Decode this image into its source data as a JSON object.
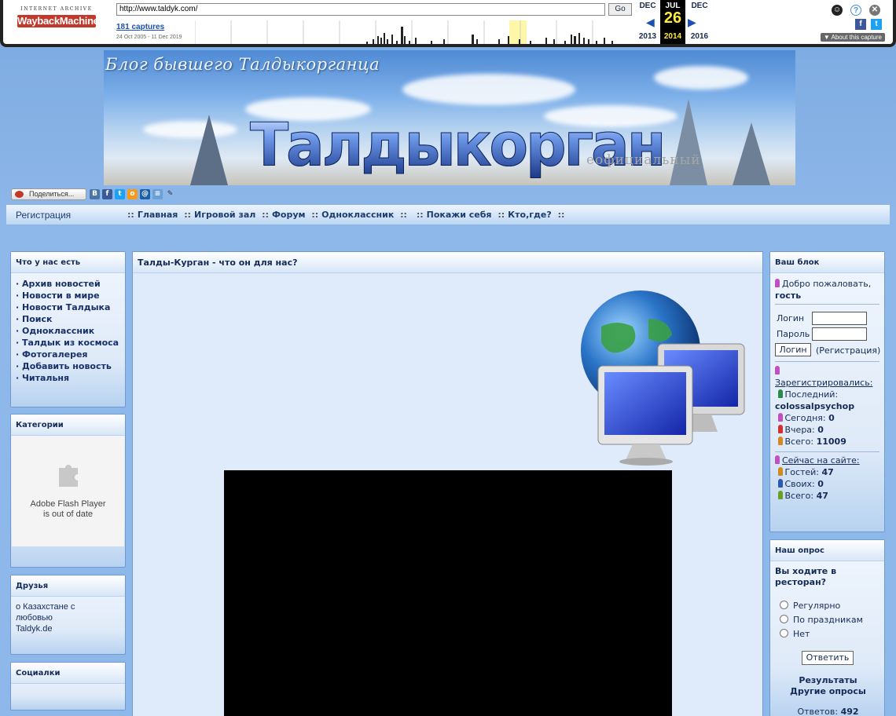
{
  "wayback": {
    "url": "http://www.taldyk.com/",
    "go_label": "Go",
    "captures": "181 captures",
    "range": "24 Oct 2005 - 11 Dec 2019",
    "logo_top": "INTERNET ARCHIVE",
    "logo_main": "WaybackMachine",
    "prev_month": "DEC",
    "cur_month": "JUL",
    "next_month": "DEC",
    "cur_day": "26",
    "prev_year": "2013",
    "cur_year": "2014",
    "next_year": "2016",
    "about": "▼ About this capture",
    "icons": [
      "user-icon",
      "help-icon",
      "close-icon",
      "facebook-icon",
      "twitter-icon"
    ]
  },
  "header": {
    "blog_title": "Блог бывшего Талдыкорганца",
    "city": "Талдыкорган",
    "unofficial": "еофициальный"
  },
  "share": {
    "label": "Поделиться...",
    "icons": [
      "vk-icon",
      "facebook-icon",
      "twitter-icon",
      "odnoklassniki-icon",
      "mailru-icon",
      "liveinternet-icon",
      "bookmark-icon"
    ]
  },
  "nav": {
    "register": "Регистрация",
    "links": [
      "Главная",
      "Игровой зал",
      "Форум",
      "Одноклассник",
      "",
      "Покажи себя",
      "Кто,где?"
    ]
  },
  "left": {
    "menu_title": "Что у нас есть",
    "menu": [
      "· Архив новостей",
      "· Новости в мире",
      "· Новости Талдыка",
      "· Поиск",
      "· Одноклассник",
      "· Талдык из космоса",
      "· Фотогалерея",
      "· Добавить новость",
      "· Читальня"
    ],
    "categories_title": "Категории",
    "flash_line1": "Adobe Flash Player",
    "flash_line2": "is out of date",
    "friends_title": "Друзья",
    "friends": [
      "о Казахстане с",
      "любовью",
      "Taldyk.de"
    ],
    "social_title": "Социалки"
  },
  "center": {
    "title": "Талды-Курган - что он для нас?"
  },
  "right": {
    "block_title": "Ваш блок",
    "welcome": "Добро пожаловать,",
    "guest": "гость",
    "login_label": "Логин",
    "password_label": "Пароль",
    "login_button": "Логин",
    "register_link": "(Регистрация)",
    "registered_title": "Зарегистрировались:",
    "last_label": "Последний:",
    "last_user": "colossalpsychop",
    "today_label": "Сегодня:",
    "today": "0",
    "yesterday_label": "Вчера:",
    "yesterday": "0",
    "total_label": "Всего:",
    "total": "11009",
    "online_title": "Сейчас на сайте:",
    "guests_label": "Гостей:",
    "guests": "47",
    "members_label": "Своих:",
    "members": "0",
    "online_total_label": "Всего:",
    "online_total": "47",
    "poll_title": "Наш опрос",
    "poll_question": "Вы ходите в ресторан?",
    "poll_options": [
      "Регулярно",
      "По праздникам",
      "Нет"
    ],
    "vote_button": "Ответить",
    "results": "Результаты",
    "other_polls": "Другие опросы",
    "answers_label": "Ответов:",
    "answers": "492"
  }
}
